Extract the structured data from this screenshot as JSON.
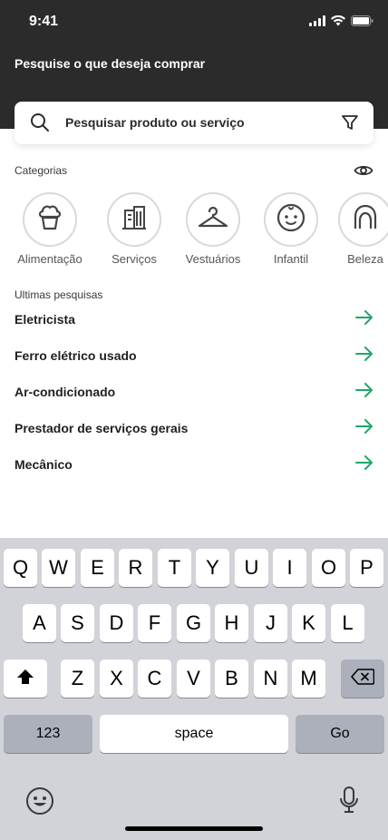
{
  "status": {
    "time": "9:41"
  },
  "header": {
    "title": "Pesquise o que deseja comprar"
  },
  "search": {
    "placeholder": "Pesquisar produto ou serviço"
  },
  "categories": {
    "title": "Categorias",
    "items": [
      {
        "label": "Alimentação",
        "icon": "cupcake-icon"
      },
      {
        "label": "Serviços",
        "icon": "building-icon"
      },
      {
        "label": "Vestuários",
        "icon": "hanger-icon"
      },
      {
        "label": "Infantil",
        "icon": "baby-icon"
      },
      {
        "label": "Beleza",
        "icon": "beauty-icon"
      }
    ]
  },
  "recent": {
    "title": "Ultimas pesquisas",
    "items": [
      "Eletricista",
      "Ferro elétrico usado",
      "Ar-condicionado",
      "Prestador de serviços gerais",
      "Mecânico"
    ]
  },
  "keyboard": {
    "row1": [
      "Q",
      "W",
      "E",
      "R",
      "T",
      "Y",
      "U",
      "I",
      "O",
      "P"
    ],
    "row2": [
      "A",
      "S",
      "D",
      "F",
      "G",
      "H",
      "J",
      "K",
      "L"
    ],
    "row3": [
      "Z",
      "X",
      "C",
      "V",
      "B",
      "N",
      "M"
    ],
    "numbers": "123",
    "space": "space",
    "go": "Go"
  },
  "colors": {
    "header": "#2b2b2b",
    "accent": "#1ea86a",
    "keyboard": "#d1d3d9"
  }
}
